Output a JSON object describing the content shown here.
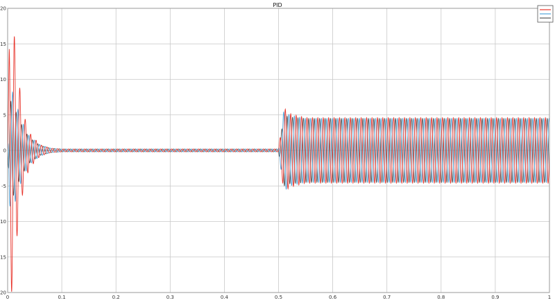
{
  "chart_data": {
    "type": "line",
    "title": "PID",
    "xlabel": "",
    "ylabel": "",
    "xlim": [
      0,
      1
    ],
    "ylim": [
      -20,
      20
    ],
    "grid": true,
    "legend_position": "top-right",
    "x_ticks": [
      0,
      0.1,
      0.2,
      0.3,
      0.4,
      0.5,
      0.6,
      0.7,
      0.8,
      0.9,
      1
    ],
    "x_tick_labels": [
      "0",
      "0.1",
      "0.2",
      "0.3",
      "0.4",
      "0.5",
      "0.6",
      "0.7",
      "0.8",
      "0.9",
      "1"
    ],
    "y_ticks": [
      -20,
      -15,
      -10,
      -5,
      0,
      5,
      10,
      15,
      20
    ],
    "y_tick_labels": [
      "-20",
      "-15",
      "-10",
      "-5",
      "0",
      "5",
      "10",
      "15",
      "20"
    ],
    "frequency_hz": 100,
    "series": [
      {
        "color": "#e8352c",
        "phase_deg": 0,
        "x": [
          0,
          0.003,
          0.006,
          0.01,
          0.015,
          0.02,
          0.03,
          0.04,
          0.06,
          0.08,
          0.1,
          0.5,
          0.505,
          0.51,
          0.52,
          0.55,
          1.0
        ],
        "amplitude": [
          0,
          15,
          21,
          18,
          14,
          10,
          5,
          2.5,
          0.8,
          0.3,
          0.2,
          0.2,
          3,
          6,
          5.2,
          4.6,
          4.6
        ]
      },
      {
        "color": "#4fa3d9",
        "phase_deg": 120,
        "x": [
          0,
          0.003,
          0.006,
          0.01,
          0.015,
          0.02,
          0.03,
          0.04,
          0.06,
          0.08,
          0.1,
          0.5,
          0.505,
          0.51,
          0.52,
          0.55,
          1.0
        ],
        "amplitude": [
          0,
          7,
          9,
          8,
          7,
          5.5,
          3.5,
          2,
          0.8,
          0.3,
          0.2,
          0.2,
          3,
          5.8,
          5,
          4.5,
          4.5
        ]
      },
      {
        "color": "#555555",
        "phase_deg": 240,
        "x": [
          0,
          0.003,
          0.006,
          0.01,
          0.015,
          0.02,
          0.03,
          0.04,
          0.06,
          0.08,
          0.1,
          0.5,
          0.505,
          0.51,
          0.52,
          0.55,
          1.0
        ],
        "amplitude": [
          0,
          5,
          7,
          6.5,
          5.5,
          4.5,
          3,
          1.8,
          0.7,
          0.3,
          0.2,
          0.2,
          2.5,
          5,
          4.7,
          4.5,
          4.5
        ]
      }
    ],
    "colors": {
      "background": "#ffffff",
      "grid": "#c8c8c8",
      "axes": "#9a9a9a"
    }
  }
}
